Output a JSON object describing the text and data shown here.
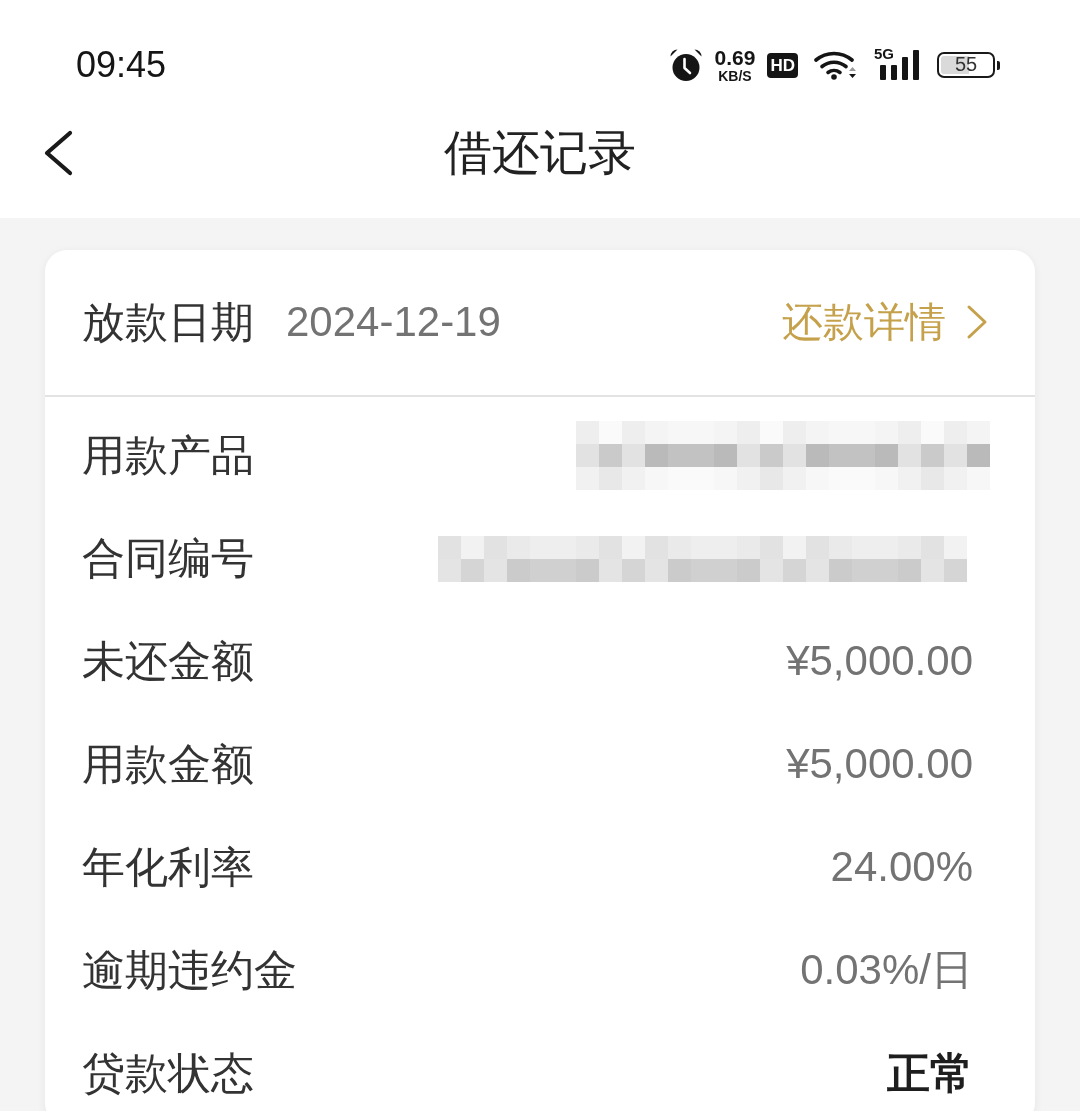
{
  "status_bar": {
    "time": "09:45",
    "net_speed": "0.69",
    "net_unit": "KB/S",
    "hd": "HD",
    "network": "5G",
    "battery": "55"
  },
  "nav": {
    "title": "借还记录"
  },
  "card": {
    "header_row": {
      "label": "放款日期",
      "value": "2024-12-19",
      "link": "还款详情"
    },
    "rows": [
      {
        "kind": "redacted",
        "label": "用款产品"
      },
      {
        "kind": "redacted",
        "label": "合同编号"
      },
      {
        "kind": "text",
        "label": "未还金额",
        "value": "¥5,000.00"
      },
      {
        "kind": "text",
        "label": "用款金额",
        "value": "¥5,000.00"
      },
      {
        "kind": "text",
        "label": "年化利率",
        "value": "24.00%"
      },
      {
        "kind": "text",
        "label": "逾期违约金",
        "value": "0.03%/日"
      },
      {
        "kind": "status",
        "label": "贷款状态",
        "value": "正常"
      }
    ]
  }
}
